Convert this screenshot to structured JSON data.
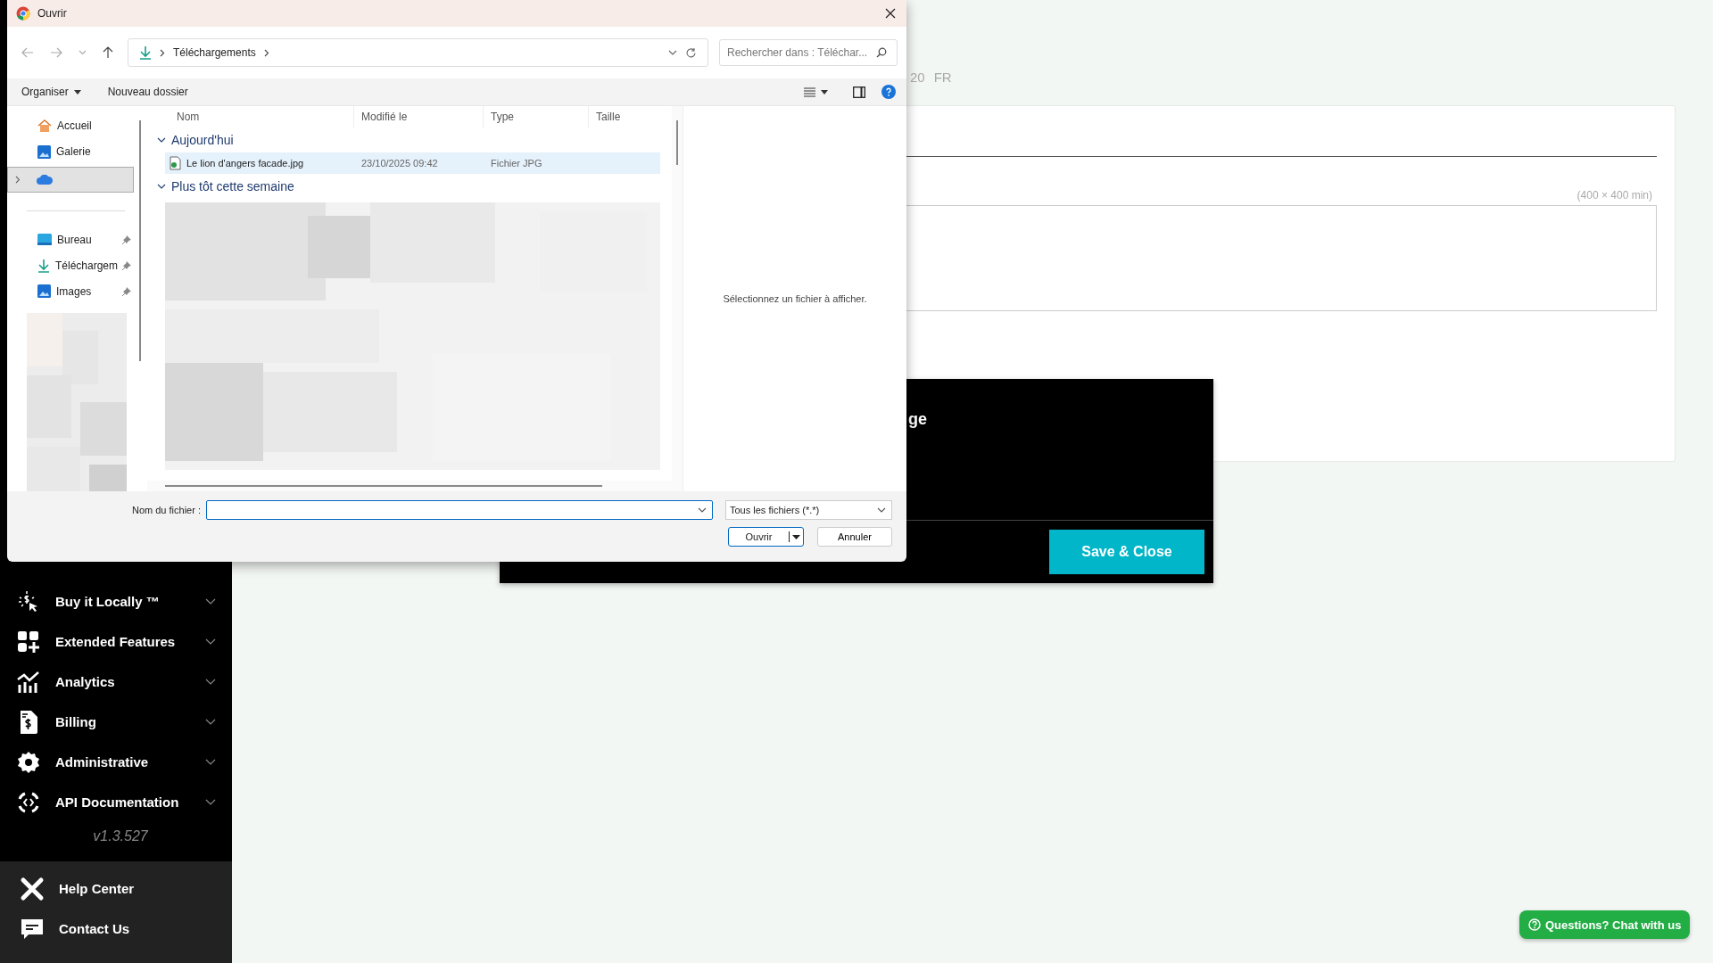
{
  "page": {
    "language_tail": "20",
    "language": "FR",
    "size_hint": "(400 × 400 min)",
    "modal_title_tail": "ge",
    "save_button": "Save & Close",
    "chat_button": "Questions? Chat with us"
  },
  "sidebar": {
    "items": [
      {
        "label": "Buy it Locally ™"
      },
      {
        "label": "Extended Features"
      },
      {
        "label": "Analytics"
      },
      {
        "label": "Billing"
      },
      {
        "label": "Administrative"
      },
      {
        "label": "API Documentation"
      }
    ],
    "version": "v1.3.527",
    "footer_items": [
      {
        "label": "Help Center"
      },
      {
        "label": "Contact Us"
      }
    ]
  },
  "file_dialog": {
    "title": "Ouvrir",
    "path": [
      "Téléchargements"
    ],
    "search_placeholder": "Rechercher dans : Téléchar...",
    "organize": "Organiser",
    "new_folder": "Nouveau dossier",
    "quick_items": [
      {
        "label": "Accueil"
      },
      {
        "label": "Galerie"
      }
    ],
    "cloud_item": {
      "selected": true,
      "expanded": false
    },
    "pinned_items": [
      {
        "label": "Bureau",
        "pinned": true
      },
      {
        "label": "Téléchargem",
        "pinned": true
      },
      {
        "label": "Images",
        "pinned": true
      }
    ],
    "columns": [
      "Nom",
      "Modifié le",
      "Type",
      "Taille"
    ],
    "groups": [
      {
        "label": "Aujourd'hui",
        "expanded": true,
        "files": [
          {
            "name": "Le lion d'angers facade.jpg",
            "modified": "23/10/2025 09:42",
            "type": "Fichier JPG",
            "selected": true
          }
        ]
      },
      {
        "label": "Plus tôt cette semaine",
        "expanded": true
      }
    ],
    "preview_message": "Sélectionnez un fichier à afficher.",
    "filename_label": "Nom du fichier :",
    "filter": "Tous les fichiers (*.*)",
    "open_button": "Ouvrir",
    "cancel_button": "Annuler"
  }
}
